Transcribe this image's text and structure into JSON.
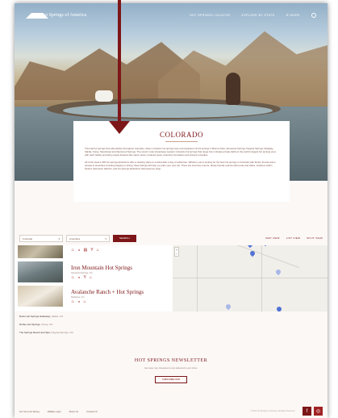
{
  "brand": {
    "name": "Hot Springs of America"
  },
  "nav": {
    "items": [
      "HOT SPRINGS LOCATOR",
      "EXPLORE BY STATE",
      "☰ MORE"
    ]
  },
  "intro": {
    "title": "COLORADO",
    "paragraphs": [
      "Thermal hot springs flow abundantly throughout Colorado, where a historic hot springs loop encompasses 19 hot springs in Buena Vista, Glenwood Springs, Pagosa Springs, Ridgway, Salida, Ouray, Steamboat and Glenwood Springs. The scenic route showcases western Colorado hot springs that range from intimate private baths to the world's largest hot springs pool, with each facility providing unique features like vapor caves, terraced pools, travertine formations and ancient remedies.",
      "All of the state's 300 hot springs attractions offer a relaxing place to unwind after a day of adventure. Whether you're looking for the best hot springs in Colorado with family, friends and a spread of amenities including lodging or dining, these listings will help you plan your next trip. There are luxurious resorts, family-friendly options with pools and slides, locations within historic downtown districts, and hot springs attractions that welcome dogs."
    ]
  },
  "filters": {
    "state": "Colorado",
    "amenities": "Amenities",
    "search_label": "SEARCH",
    "views": [
      "MAP VIEW",
      "LIST VIEW",
      "SPLIT VIEW"
    ]
  },
  "listings": [
    {
      "name": "Iron Mountain Hot Springs",
      "location": "Glenwood Springs, CO",
      "amenities": [
        "pool-icon",
        "towel-icon",
        "cocktail-icon",
        "lodging-icon"
      ]
    },
    {
      "name": "Avalanche Ranch + Hot Springs",
      "location": "Redstone, CO",
      "amenities": [
        "pool-icon",
        "towel-icon",
        "lodging-icon"
      ]
    }
  ],
  "top_listing_amenities": [
    "pool-icon",
    "towel-icon",
    "spa-icon",
    "cocktail-icon",
    "lodging-icon"
  ],
  "other_springs": [
    {
      "name": "Ruins Hot Springs Hideaway,",
      "location": "Salida, CO"
    },
    {
      "name": "Durfee Hot Springs,",
      "location": "Ouray, CO"
    },
    {
      "name": "The Springs Resort and Spa,",
      "location": "Pagosa Springs, CO"
    }
  ],
  "newsletter": {
    "title": "HOT SPRINGS NEWSLETTER",
    "subtitle": "Get news, tips, itineraries & more delivered to your inbox.",
    "button": "SUBSCRIBE NOW"
  },
  "footer": {
    "links": [
      "List Your Hot Spring",
      "Affiliate Login",
      "About Us",
      "Contact Us"
    ],
    "copyright": "© 2024 Hot Springs of America. All Rights Reserved."
  },
  "colors": {
    "accent": "#7d1618",
    "pin": "#5273d4"
  }
}
